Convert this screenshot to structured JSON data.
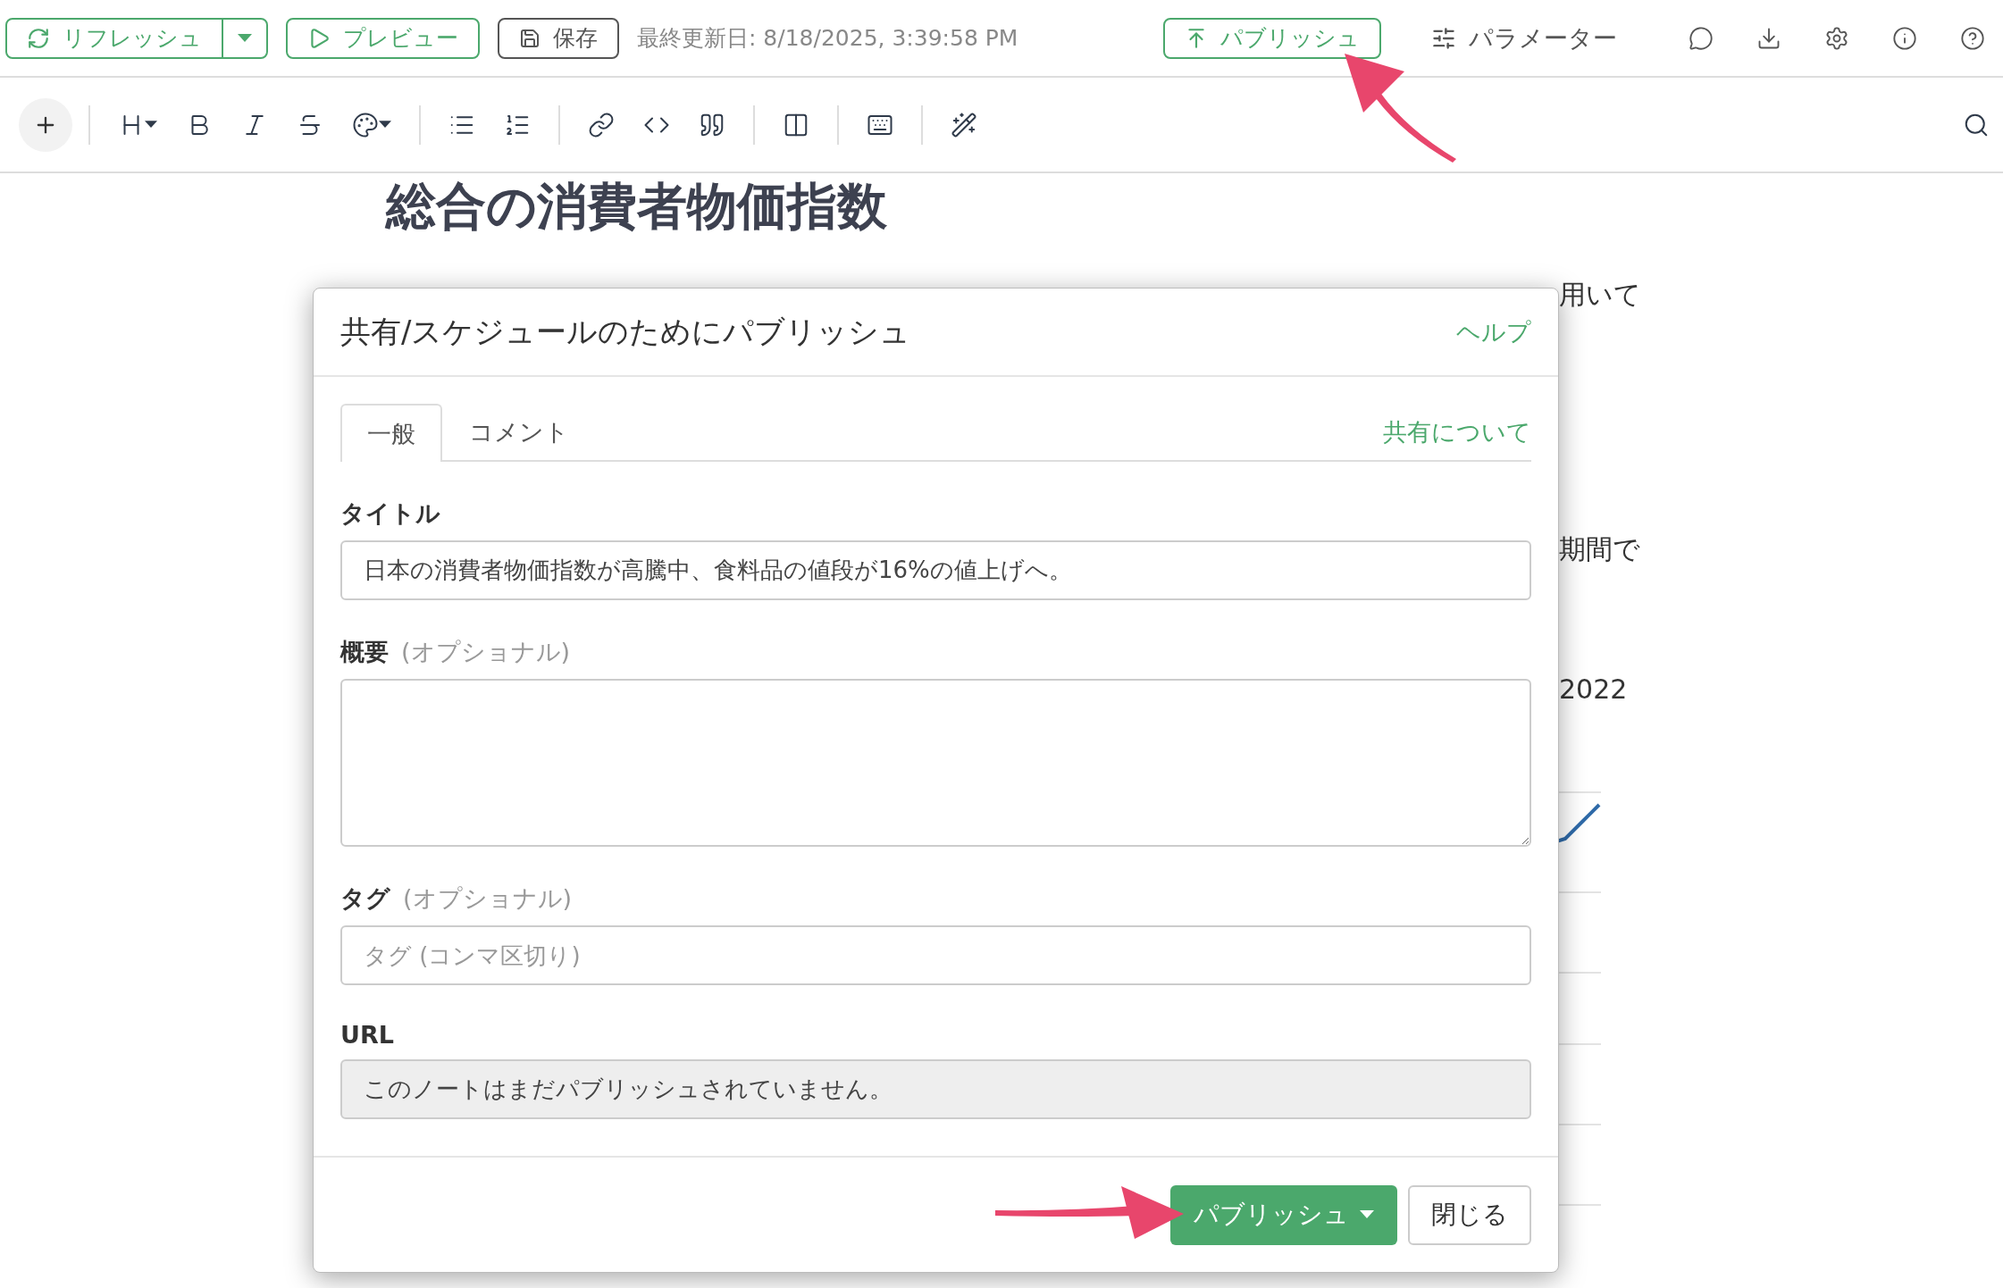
{
  "top_bar": {
    "refresh_button": {
      "label": "リフレッシュ"
    },
    "preview_button": {
      "label": "プレビュー"
    },
    "save_button": {
      "label": "保存"
    },
    "last_updated": "最終更新日: 8/18/2025, 3:39:58 PM",
    "publish_button": {
      "label": "パブリッシュ"
    },
    "parameters_button": {
      "label": "パラメーター"
    },
    "icons": [
      {
        "kind": "comment"
      },
      {
        "kind": "download"
      },
      {
        "kind": "settings"
      },
      {
        "kind": "info"
      },
      {
        "kind": "help"
      }
    ]
  },
  "editor_toolbar": {
    "groups": [
      [
        {
          "kind": "add"
        }
      ],
      [
        {
          "kind": "heading"
        },
        {
          "kind": "bold"
        },
        {
          "kind": "italic"
        },
        {
          "kind": "strikethrough"
        },
        {
          "kind": "palette"
        }
      ],
      [
        {
          "kind": "bullet-list"
        },
        {
          "kind": "numbered-list"
        }
      ],
      [
        {
          "kind": "link"
        },
        {
          "kind": "code"
        },
        {
          "kind": "quote"
        }
      ],
      [
        {
          "kind": "columns"
        }
      ],
      [
        {
          "kind": "keyboard"
        }
      ],
      [
        {
          "kind": "magic"
        }
      ]
    ],
    "search": {
      "kind": "search"
    }
  },
  "document": {
    "heading": "総合の消費者物価指数",
    "text_fragments": [
      "用いて",
      "期間で",
      "2022"
    ]
  },
  "dialog": {
    "title": "共有/スケジュールのためにパブリッシュ",
    "help_link": "ヘルプ",
    "tabs": [
      {
        "label": "一般",
        "selected": true
      },
      {
        "label": "コメント",
        "selected": false
      }
    ],
    "about_link": "共有について",
    "fields": [
      {
        "kind": "text",
        "label": "タイトル",
        "value": "日本の消費者物価指数が高騰中、食料品の値段が16%の値上げへ。"
      },
      {
        "kind": "textarea",
        "label": "概要",
        "hint": "(オプショナル)"
      },
      {
        "kind": "text",
        "label": "タグ",
        "hint": "(オプショナル)",
        "placeholder": "タグ (コンマ区切り)"
      },
      {
        "kind": "readonly",
        "label": "URL",
        "value": "このノートはまだパブリッシュされていません。"
      }
    ],
    "publish_button": {
      "label": "パブリッシュ"
    },
    "close_button": {
      "label": "閉じる"
    }
  }
}
